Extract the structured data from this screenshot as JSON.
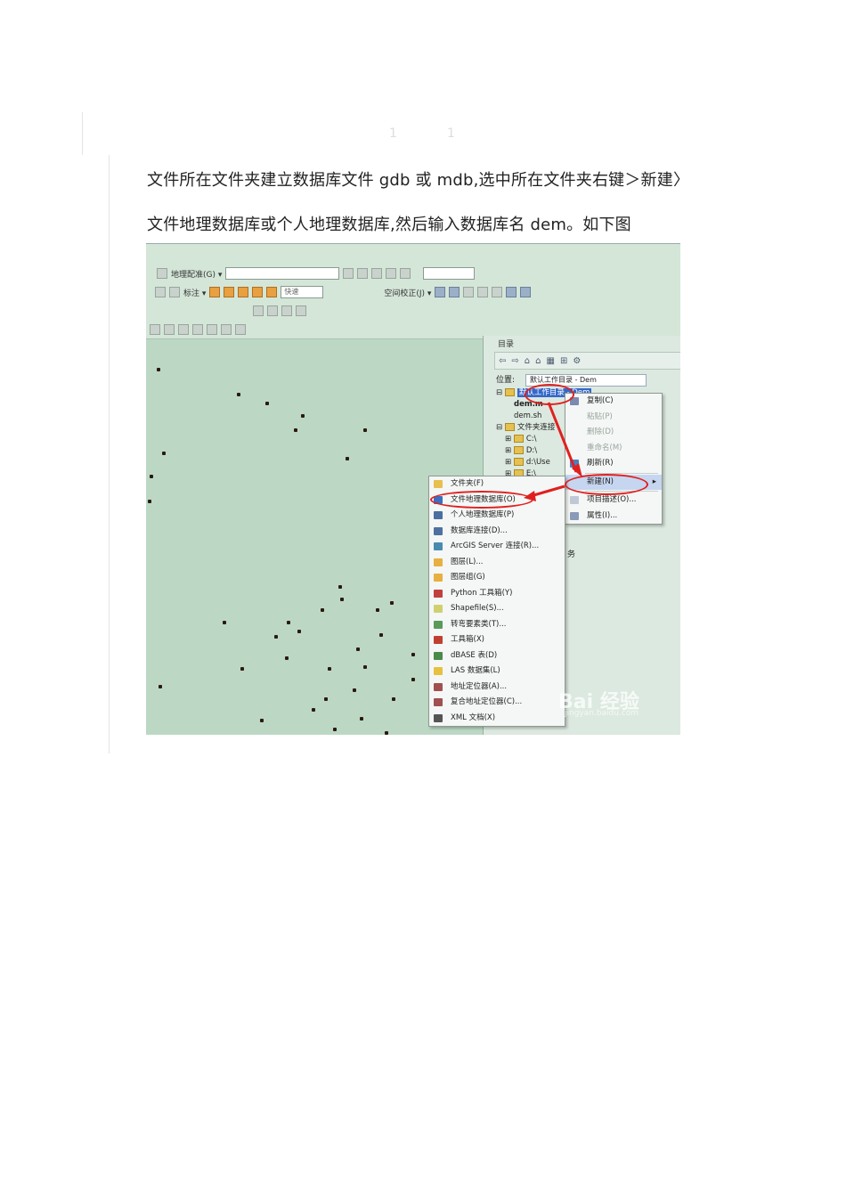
{
  "page": {
    "faint_marks": [
      "1",
      "1"
    ],
    "paragraphs": [
      "文件所在文件夹建立数据库文件 gdb 或 mdb,选中所在文件夹右键＞新建〉",
      "文件地理数据库或个人地理数据库,然后输入数据库名 dem。如下图"
    ]
  },
  "screenshot": {
    "toolbar": {
      "georef_label": "地理配准(G) ▾",
      "label_label": "标注 ▾",
      "speed_combo": "快速",
      "spatial_adjust_label": "空间校正(J) ▾"
    },
    "catalog": {
      "title": "目录",
      "location_label": "位置:",
      "location_value": "默认工作目录 - Dem",
      "tree": [
        "默认工作目录 - Dem",
        "dem.m",
        "dem.sh",
        "文件夹连接",
        "C:\\",
        "D:\\",
        "d:\\Use",
        "E:\\"
      ],
      "side_text": "务"
    },
    "context_menu": {
      "items": [
        {
          "label": "复制(C)",
          "disabled": false
        },
        {
          "label": "粘贴(P)",
          "disabled": true
        },
        {
          "label": "删除(D)",
          "disabled": true
        },
        {
          "label": "重命名(M)",
          "disabled": true
        },
        {
          "label": "刷新(R)",
          "disabled": false
        },
        {
          "label": "新建(N)",
          "disabled": false
        },
        {
          "label": "项目描述(O)...",
          "disabled": false
        },
        {
          "label": "属性(I)...",
          "disabled": false
        }
      ]
    },
    "new_submenu": {
      "items": [
        "文件夹(F)",
        "文件地理数据库(O)",
        "个人地理数据库(P)",
        "数据库连接(D)...",
        "ArcGIS Server 连接(R)...",
        "图层(L)...",
        "图层组(G)",
        "Python 工具箱(Y)",
        "Shapefile(S)...",
        "转弯要素类(T)...",
        "工具箱(X)",
        "dBASE 表(D)",
        "LAS 数据集(L)",
        "地址定位器(A)...",
        "复合地址定位器(C)...",
        "XML 文档(X)"
      ],
      "icon_colors": [
        "#e6c050",
        "#3a70c0",
        "#4a6fa0",
        "#5070a0",
        "#4a8ab0",
        "#e8b040",
        "#e8b040",
        "#c04040",
        "#d0d070",
        "#5a9a5a",
        "#c04030",
        "#4a8a4a",
        "#e8c040",
        "#a05050",
        "#a05050",
        "#555555"
      ]
    },
    "watermark": "Bai 经验",
    "watermark_sub": "jingyan.baidu.com"
  }
}
